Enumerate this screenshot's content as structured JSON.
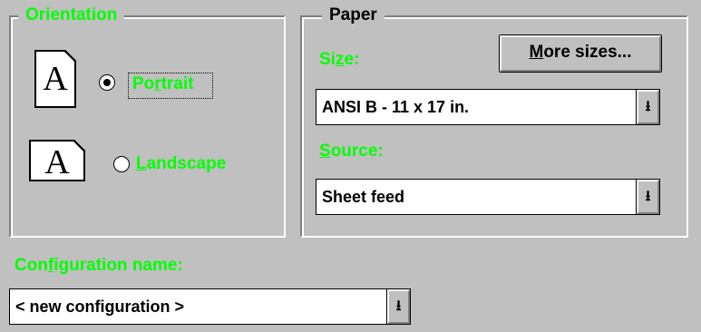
{
  "orientation": {
    "title": "Orientation",
    "portrait": {
      "label_before": "Po",
      "label_underline": "r",
      "label_after": "trait",
      "selected": true,
      "icon": "page-portrait-icon",
      "icon_letter": "A"
    },
    "landscape": {
      "label_before": "",
      "label_underline": "L",
      "label_after": "andscape",
      "selected": false,
      "icon": "page-landscape-icon",
      "icon_letter": "A"
    }
  },
  "paper": {
    "title": "Paper",
    "size_label_before": "Si",
    "size_label_underline": "z",
    "size_label_after": "e:",
    "more_sizes_underline": "M",
    "more_sizes_rest": "ore sizes...",
    "size_value": "ANSI B - 11 x 17 in.",
    "source_label_underline": "S",
    "source_label_rest": "ource:",
    "source_value": "Sheet feed"
  },
  "configuration": {
    "label_before": "Con",
    "label_underline": "f",
    "label_after": "iguration name:",
    "value": "< new configuration >"
  },
  "icons": {
    "dropdown": "dropdown-arrow-icon",
    "dropdown_glyph": "⭳"
  },
  "colors": {
    "background": "#c0c0c0",
    "label_accent": "#00ff00",
    "text": "#000000"
  }
}
